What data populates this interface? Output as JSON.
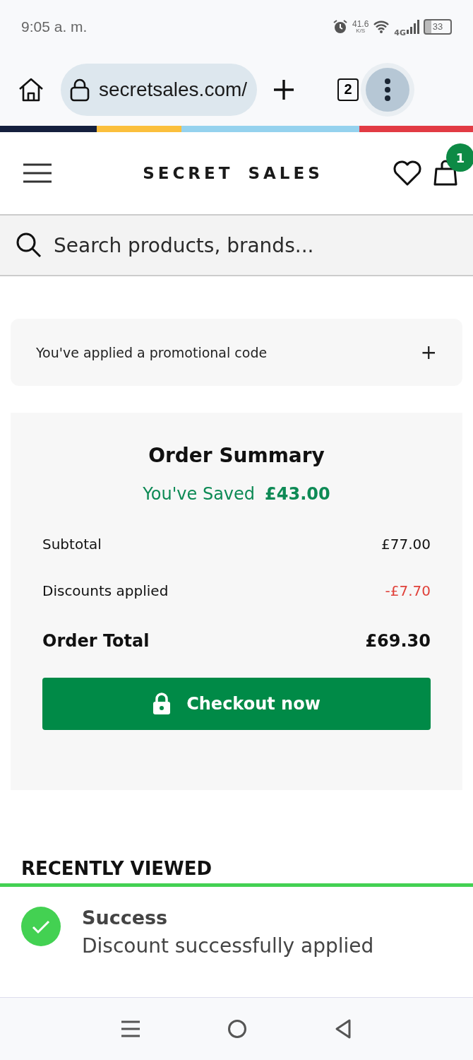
{
  "status_bar": {
    "time": "9:05 a. m.",
    "net_speed": "41.6",
    "net_unit": "K/S",
    "network": "4G",
    "battery": "33"
  },
  "browser": {
    "url": "secretsales.com/",
    "tab_count": "2"
  },
  "header": {
    "logo": "SECRET SALES",
    "cart_count": "1"
  },
  "search": {
    "placeholder": "Search products, brands..."
  },
  "promo": {
    "label": "You've applied a promotional code",
    "toggle": "+",
    "expanded": false
  },
  "order_summary": {
    "title": "Order Summary",
    "saved_label": "You've Saved",
    "saved_amount": "£43.00",
    "rows": [
      {
        "kind": "normal",
        "label": "Subtotal",
        "value": "£77.00"
      },
      {
        "kind": "discount",
        "label": "Discounts applied",
        "value": "-£7.70"
      },
      {
        "kind": "total",
        "label": "Order Total",
        "value": "£69.30"
      }
    ],
    "checkout": "Checkout now"
  },
  "recently_viewed": {
    "title": "RECENTLY VIEWED"
  },
  "toast": {
    "title": "Success",
    "message": "Discount successfully applied"
  }
}
